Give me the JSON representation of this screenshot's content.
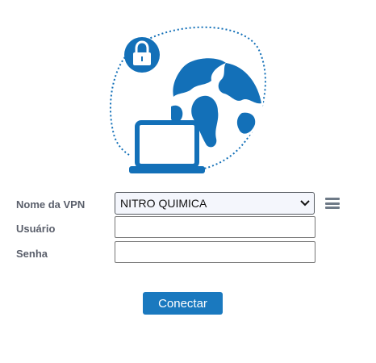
{
  "form": {
    "vpn_label": "Nome da VPN",
    "vpn_selected": "NITRO QUIMICA",
    "user_label": "Usuário",
    "user_value": "",
    "password_label": "Senha",
    "password_value": ""
  },
  "actions": {
    "connect_label": "Conectar"
  },
  "icons": {
    "hero": "vpn-globe-laptop-lock-illustration",
    "menu": "hamburger-menu-icon",
    "select": "chevron-down-icon"
  },
  "colors": {
    "brand_blue": "#1a79bf",
    "illustration_blue": "#1370b8",
    "label_gray": "#5a5f6b",
    "menu_gray": "#6e7a87"
  }
}
